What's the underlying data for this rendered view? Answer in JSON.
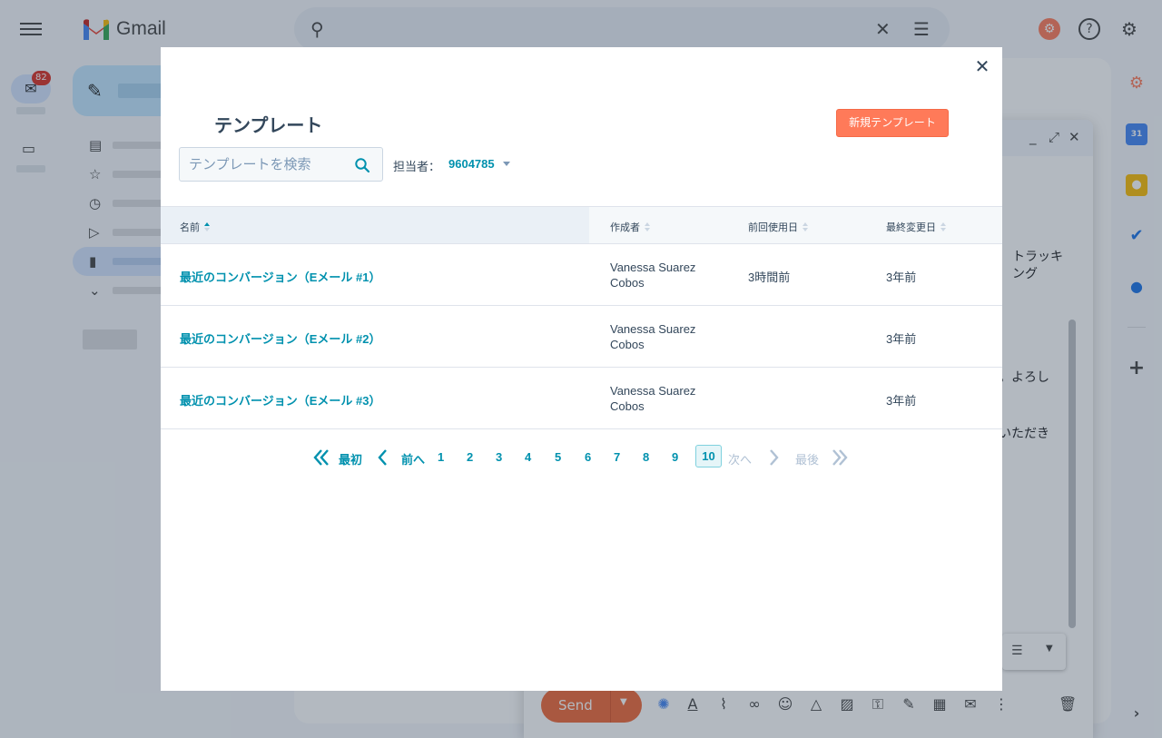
{
  "gmail": {
    "title": "Gmail",
    "unread_badge": "82",
    "compose_snippets": [
      "トラッキ",
      "ング",
      "。よろし",
      "いただき"
    ],
    "send_label": "Send"
  },
  "modal": {
    "title": "テンプレート",
    "new_button": "新規テンプレート",
    "search_placeholder": "テンプレートを検索",
    "owner_label": "担当者：",
    "owner_value": "9604785",
    "close": "✕"
  },
  "table": {
    "headers": {
      "name": "名前",
      "author": "作成者",
      "last_used": "前回使用日",
      "modified": "最終変更日"
    },
    "rows": [
      {
        "name": "最近のコンバージョン（Eメール #1）",
        "author": "Vanessa Suarez Cobos",
        "last_used": "3時間前",
        "modified": "3年前"
      },
      {
        "name": "最近のコンバージョン（Eメール #2）",
        "author": "Vanessa Suarez Cobos",
        "last_used": "",
        "modified": "3年前"
      },
      {
        "name": "最近のコンバージョン（Eメール #3）",
        "author": "Vanessa Suarez Cobos",
        "last_used": "",
        "modified": "3年前"
      }
    ]
  },
  "pagination": {
    "first": "最初",
    "prev": "前へ",
    "pages": [
      "1",
      "2",
      "3",
      "4",
      "5",
      "6",
      "7",
      "8",
      "9"
    ],
    "current": "10",
    "next": "次へ",
    "last": "最後"
  },
  "colors": {
    "accent": "#0091ae",
    "primary_button": "#ff7a59",
    "text": "#33475b",
    "gmail_send": "#f06838"
  }
}
